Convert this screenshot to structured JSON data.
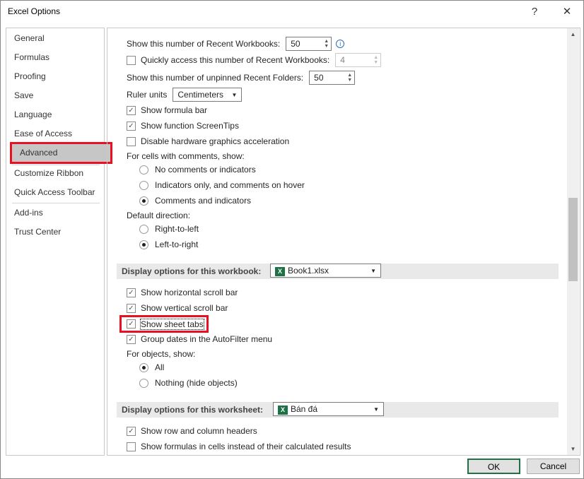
{
  "window": {
    "title": "Excel Options",
    "help": "?",
    "close": "✕"
  },
  "nav": [
    "General",
    "Formulas",
    "Proofing",
    "Save",
    "Language",
    "Ease of Access",
    "Advanced",
    "Customize Ribbon",
    "Quick Access Toolbar",
    "Add-ins",
    "Trust Center"
  ],
  "opts": {
    "recent_wb_label": "Show this number of Recent Workbooks:",
    "recent_wb_value": "50",
    "quick_label": "Quickly access this number of Recent Workbooks:",
    "quick_value": "4",
    "folders_label": "Show this number of unpinned Recent Folders:",
    "folders_value": "50",
    "ruler_label": "Ruler units",
    "ruler_value": "Centimeters",
    "formula_bar": "Show formula bar",
    "screentips": "Show function ScreenTips",
    "hw_accel": "Disable hardware graphics acceleration",
    "comments_label": "For cells with comments, show:",
    "c1": "No comments or indicators",
    "c2": "Indicators only, and comments on hover",
    "c3": "Comments and indicators",
    "dir_label": "Default direction:",
    "d1": "Right-to-left",
    "d2": "Left-to-right",
    "wb_header": "Display options for this workbook:",
    "wb_value": "Book1.xlsx",
    "hscroll": "Show horizontal scroll bar",
    "vscroll": "Show vertical scroll bar",
    "sheet_tabs": "Show sheet tabs",
    "group_dates": "Group dates in the AutoFilter menu",
    "objects_label": "For objects, show:",
    "o1": "All",
    "o2": "Nothing (hide objects)",
    "ws_header": "Display options for this worksheet:",
    "ws_value": "Bán đá",
    "row_col": "Show row and column headers",
    "formulas": "Show formulas in cells instead of their calculated results"
  },
  "buttons": {
    "ok": "OK",
    "cancel": "Cancel"
  },
  "colors": {
    "highlight": "#e81123",
    "excel": "#1e7145"
  }
}
